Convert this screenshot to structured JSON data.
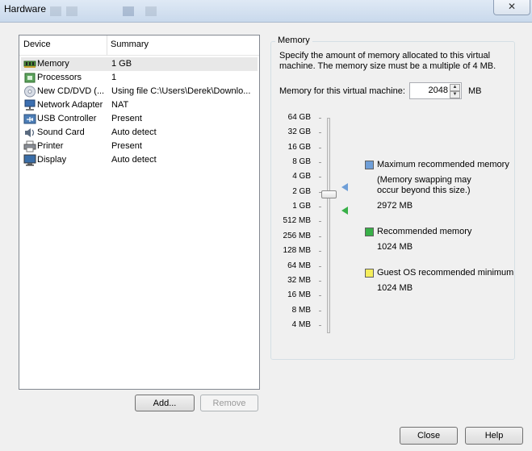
{
  "window": {
    "title": "Hardware",
    "close_glyph": "✕"
  },
  "device_list": {
    "headers": {
      "device": "Device",
      "summary": "Summary"
    },
    "rows": [
      {
        "device": "Memory",
        "summary": "1 GB",
        "icon": "memory-icon"
      },
      {
        "device": "Processors",
        "summary": "1",
        "icon": "processor-icon"
      },
      {
        "device": "New CD/DVD (...",
        "summary": "Using file C:\\Users\\Derek\\Downlo...",
        "icon": "cd-dvd-icon"
      },
      {
        "device": "Network Adapter",
        "summary": "NAT",
        "icon": "network-adapter-icon"
      },
      {
        "device": "USB Controller",
        "summary": "Present",
        "icon": "usb-icon"
      },
      {
        "device": "Sound Card",
        "summary": "Auto detect",
        "icon": "sound-card-icon"
      },
      {
        "device": "Printer",
        "summary": "Present",
        "icon": "printer-icon"
      },
      {
        "device": "Display",
        "summary": "Auto detect",
        "icon": "display-icon"
      }
    ]
  },
  "buttons": {
    "add": "Add...",
    "remove": "Remove",
    "close": "Close",
    "help": "Help"
  },
  "memory": {
    "group_label": "Memory",
    "description": "Specify the amount of memory allocated to this virtual machine. The memory size must be a multiple of 4 MB.",
    "field_label": "Memory for this virtual machine:",
    "value": "2048",
    "unit": "MB",
    "slider_value_mb": 2048,
    "scale": [
      "64 GB",
      "32 GB",
      "16 GB",
      "8 GB",
      "4 GB",
      "2 GB",
      "1 GB",
      "512 MB",
      "256 MB",
      "128 MB",
      "64 MB",
      "32 MB",
      "16 MB",
      "8 MB",
      "4 MB"
    ],
    "legend": {
      "max_title": "Maximum recommended memory",
      "max_note": "(Memory swapping may occur beyond this size.)",
      "max_value": "2972 MB",
      "rec_title": "Recommended memory",
      "rec_value": "1024 MB",
      "guest_title": "Guest OS recommended minimum",
      "guest_value": "1024 MB"
    },
    "colors": {
      "max": "#6f9fd8",
      "recommended": "#38b048",
      "guest": "#f5ee5c"
    }
  }
}
